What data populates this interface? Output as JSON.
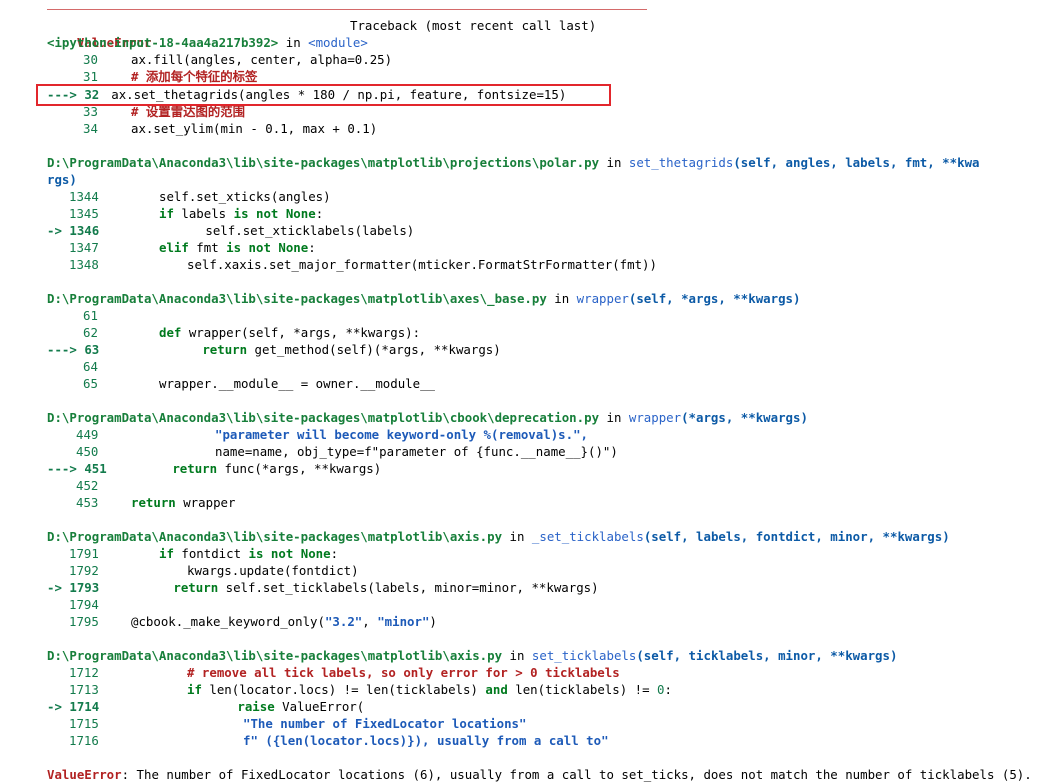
{
  "traceback": {
    "error_name": "ValueError",
    "header_right": "Traceback (most recent call last)",
    "first_frame": {
      "file": "<ipython-input-18-4aa4a217b392>",
      "in_word": "in",
      "func": "<module>",
      "lines": [
        {
          "no": "30",
          "arrow": "",
          "code": "ax.fill(angles, center, alpha=0.25)"
        },
        {
          "no": "31",
          "arrow": "",
          "code": "# 添加每个特征的标签"
        },
        {
          "no": "32",
          "arrow": "---> ",
          "code": "ax.set_thetagrids(angles * 180 / np.pi, feature, fontsize=15)"
        },
        {
          "no": "33",
          "arrow": "",
          "code": "# 设置雷达图的范围"
        },
        {
          "no": "34",
          "arrow": "",
          "code": "ax.set_ylim(min - 0.1, max + 0.1)"
        }
      ]
    },
    "frames": [
      {
        "file": "D:\\ProgramData\\Anaconda3\\lib\\site-packages\\matplotlib\\projections\\polar.py",
        "func": "set_thetagrids",
        "args": "(self, angles, labels, fmt, **kwargs)",
        "lines": [
          {
            "no": "1344",
            "arrow": "",
            "code": "self.set_xticks(angles)"
          },
          {
            "no": "1345",
            "arrow": "",
            "code": "if labels is not None:"
          },
          {
            "no": "1346",
            "arrow": "-> ",
            "code": "self.set_xticklabels(labels)"
          },
          {
            "no": "1347",
            "arrow": "",
            "code": "elif fmt is not None:"
          },
          {
            "no": "1348",
            "arrow": "",
            "code": "self.xaxis.set_major_formatter(mticker.FormatStrFormatter(fmt))"
          }
        ]
      },
      {
        "file": "D:\\ProgramData\\Anaconda3\\lib\\site-packages\\matplotlib\\axes\\_base.py",
        "func": "wrapper",
        "args": "(self, *args, **kwargs)",
        "lines": [
          {
            "no": "61",
            "arrow": "",
            "code": ""
          },
          {
            "no": "62",
            "arrow": "",
            "code": "def wrapper(self, *args, **kwargs):"
          },
          {
            "no": "63",
            "arrow": "---> ",
            "code": "return get_method(self)(*args, **kwargs)"
          },
          {
            "no": "64",
            "arrow": "",
            "code": ""
          },
          {
            "no": "65",
            "arrow": "",
            "code": "wrapper.__module__ = owner.__module__"
          }
        ]
      },
      {
        "file": "D:\\ProgramData\\Anaconda3\\lib\\site-packages\\matplotlib\\cbook\\deprecation.py",
        "func": "wrapper",
        "args": "(*args, **kwargs)",
        "lines": [
          {
            "no": "449",
            "arrow": "",
            "code": "\"parameter will become keyword-only %(removal)s.\","
          },
          {
            "no": "450",
            "arrow": "",
            "code": "name=name, obj_type=f\"parameter of {func.__name__}()\")"
          },
          {
            "no": "451",
            "arrow": "---> ",
            "code": "return func(*args, **kwargs)"
          },
          {
            "no": "452",
            "arrow": "",
            "code": ""
          },
          {
            "no": "453",
            "arrow": "",
            "code": "return wrapper"
          }
        ]
      },
      {
        "file": "D:\\ProgramData\\Anaconda3\\lib\\site-packages\\matplotlib\\axis.py",
        "func": "_set_ticklabels",
        "args": "(self, labels, fontdict, minor, **kwargs)",
        "lines": [
          {
            "no": "1791",
            "arrow": "",
            "code": "if fontdict is not None:"
          },
          {
            "no": "1792",
            "arrow": "",
            "code": "kwargs.update(fontdict)"
          },
          {
            "no": "1793",
            "arrow": "-> ",
            "code": "return self.set_ticklabels(labels, minor=minor, **kwargs)"
          },
          {
            "no": "1794",
            "arrow": "",
            "code": ""
          },
          {
            "no": "1795",
            "arrow": "",
            "code": "@cbook._make_keyword_only(\"3.2\", \"minor\")"
          }
        ]
      },
      {
        "file": "D:\\ProgramData\\Anaconda3\\lib\\site-packages\\matplotlib\\axis.py",
        "func": "set_ticklabels",
        "args": "(self, ticklabels, minor, **kwargs)",
        "lines": [
          {
            "no": "1712",
            "arrow": "",
            "code": "# remove all tick labels, so only error for > 0 ticklabels"
          },
          {
            "no": "1713",
            "arrow": "",
            "code": "if len(locator.locs) != len(ticklabels) and len(ticklabels) != 0:"
          },
          {
            "no": "1714",
            "arrow": "-> ",
            "code": "raise ValueError("
          },
          {
            "no": "1715",
            "arrow": "",
            "code": "\"The number of FixedLocator locations\""
          },
          {
            "no": "1716",
            "arrow": "",
            "code": "f\" ({len(locator.locs)}), usually from a call to\""
          }
        ]
      }
    ],
    "final_error": {
      "name": "ValueError",
      "message": ": The number of FixedLocator locations (6), usually from a call to set_ticks, does not match the number of ticklabels (5)."
    }
  }
}
